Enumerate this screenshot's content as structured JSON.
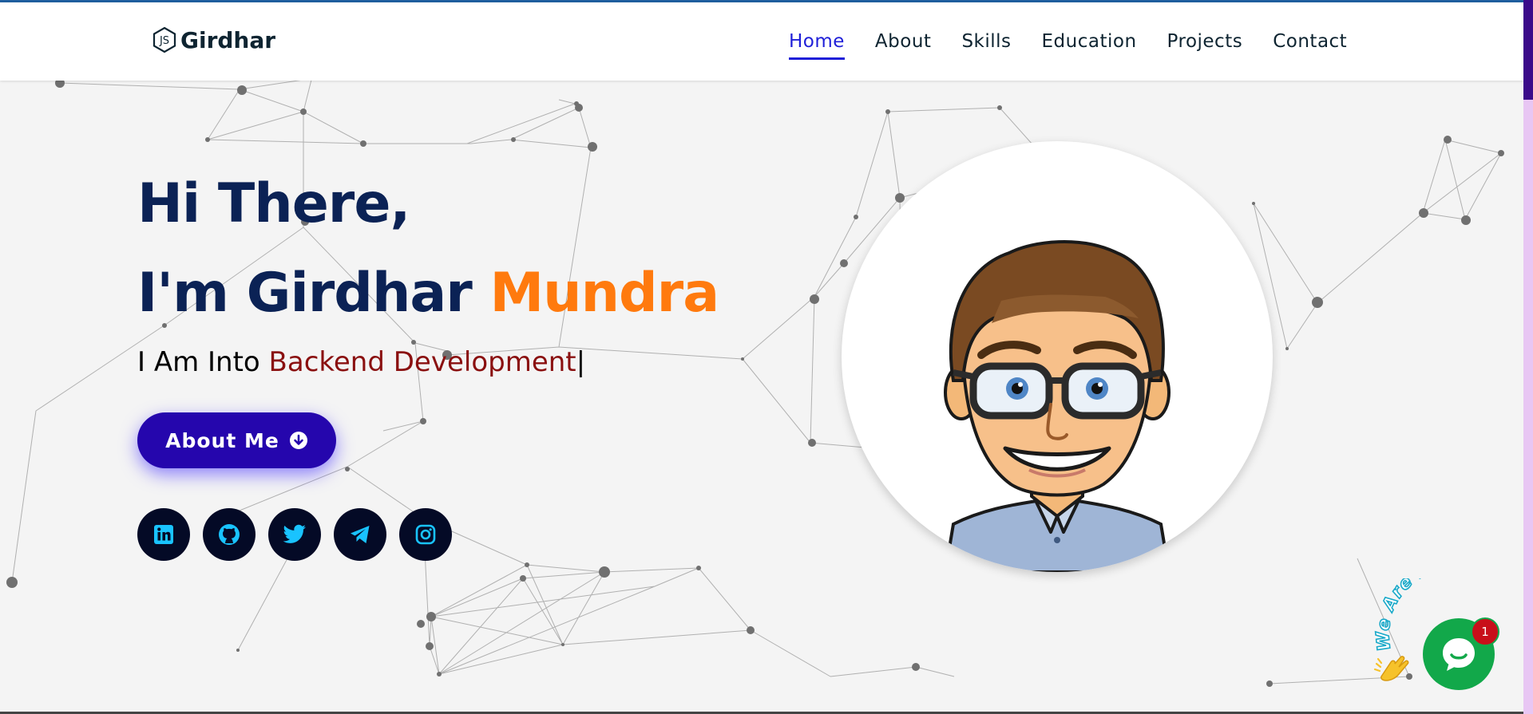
{
  "nav": {
    "brand": "Girdhar",
    "links": [
      {
        "label": "Home",
        "active": true
      },
      {
        "label": "About"
      },
      {
        "label": "Skills"
      },
      {
        "label": "Education"
      },
      {
        "label": "Projects"
      },
      {
        "label": "Contact"
      }
    ]
  },
  "hero": {
    "greeting": "Hi There,",
    "intro": "I'm Girdhar",
    "surname": "Mundra",
    "tagline_prefix": "I Am Into",
    "tagline_typed": "Backend Development",
    "cursor": "|",
    "button_label": "About Me",
    "socials": [
      {
        "icon": "linkedin-icon"
      },
      {
        "icon": "github-icon"
      },
      {
        "icon": "twitter-icon"
      },
      {
        "icon": "telegram-icon"
      },
      {
        "icon": "instagram-icon"
      }
    ]
  },
  "chat": {
    "banner": "We Are Here!",
    "badge_count": "1",
    "wave_icon": "waving-hand-icon"
  },
  "colors": {
    "heading": "#0b2255",
    "accent_orange": "#ff7a0e",
    "typed_red": "#8a1010",
    "button": "#2506ad",
    "nav_active": "#1f1fd8",
    "social_bg": "#040a26",
    "social_icon": "#19c3ff",
    "chat_green": "#12a84a"
  }
}
